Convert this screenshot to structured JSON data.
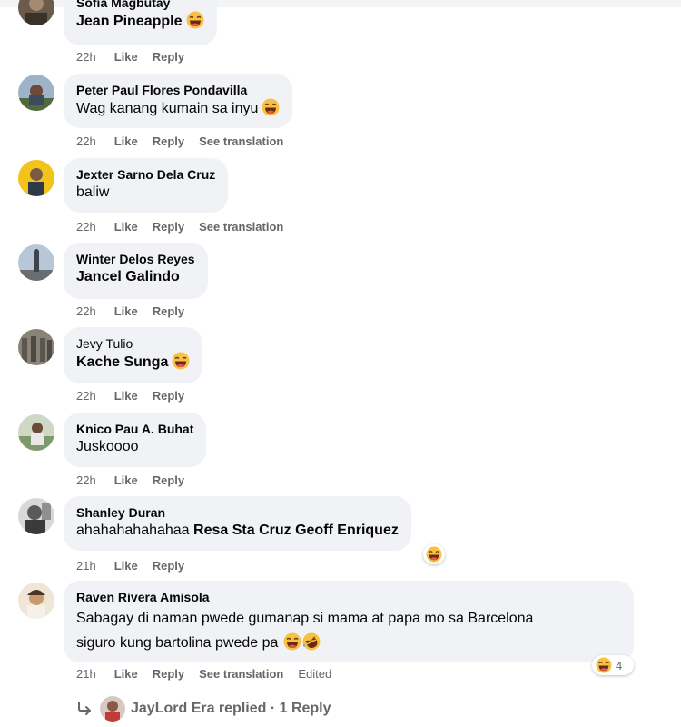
{
  "comments": [
    {
      "name": "Sofia Magbutay",
      "text": "Jean Pineapple",
      "time": "22h",
      "actions": [
        "Like",
        "Reply"
      ]
    },
    {
      "name": "Peter Paul Flores Pondavilla",
      "text": "Wag kanang kumain sa inyu",
      "time": "22h",
      "actions": [
        "Like",
        "Reply",
        "See translation"
      ]
    },
    {
      "name": "Jexter Sarno Dela Cruz",
      "text": "baliw",
      "time": "22h",
      "actions": [
        "Like",
        "Reply",
        "See translation"
      ]
    },
    {
      "name": "Winter Delos Reyes",
      "text": "Jancel Galindo",
      "time": "22h",
      "actions": [
        "Like",
        "Reply"
      ]
    },
    {
      "name": "Jevy Tulio",
      "text": "Kache Sunga",
      "time": "22h",
      "actions": [
        "Like",
        "Reply"
      ]
    },
    {
      "name": "Knico Pau A. Buhat",
      "text": "Juskoooo",
      "time": "22h",
      "actions": [
        "Like",
        "Reply"
      ]
    },
    {
      "name": "Shanley Duran",
      "text_plain": "ahahahahahahaa ",
      "text_tags": "Resa Sta Cruz Geoff Enriquez",
      "time": "21h",
      "actions": [
        "Like",
        "Reply"
      ]
    },
    {
      "name": "Raven Rivera Amisola",
      "text_line1": "Sabagay di naman pwede gumanap si mama at papa mo sa Barcelona",
      "text_line2": "siguro kung bartolina pwede pa",
      "time": "21h",
      "actions": [
        "Like",
        "Reply",
        "See translation"
      ],
      "edited": "Edited",
      "reaction_count": "4"
    }
  ],
  "replies": {
    "text": "JayLord Era replied · 1 Reply"
  },
  "icons": {
    "reply_arrow": "reply-arrow-icon",
    "laugh": "laughing-emoji-icon",
    "rofl": "rolling-laughing-emoji-icon"
  }
}
